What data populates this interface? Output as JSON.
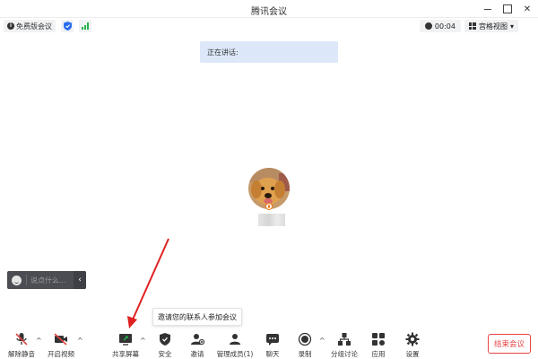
{
  "window": {
    "title": "腾讯会议"
  },
  "infobar": {
    "meeting_type": "免费版会议",
    "timer": "00:04",
    "view_mode": "宫格视图"
  },
  "speaking": {
    "label": "正在讲话:"
  },
  "chat": {
    "placeholder": "说点什么..."
  },
  "tooltip": {
    "text": "邀请您的联系人参加会议"
  },
  "toolbar": {
    "items": [
      {
        "label": "解除静音",
        "icon": "mic-muted-icon"
      },
      {
        "label": "开启视频",
        "icon": "video-off-icon"
      },
      {
        "label": "共享屏幕",
        "icon": "share-screen-icon"
      },
      {
        "label": "安全",
        "icon": "shield-icon"
      },
      {
        "label": "邀请",
        "icon": "invite-icon"
      },
      {
        "label": "管理成员(1)",
        "icon": "members-icon"
      },
      {
        "label": "聊天",
        "icon": "chat-icon"
      },
      {
        "label": "录制",
        "icon": "record-icon"
      },
      {
        "label": "分组讨论",
        "icon": "breakout-icon"
      },
      {
        "label": "应用",
        "icon": "apps-icon"
      },
      {
        "label": "设置",
        "icon": "gear-icon"
      }
    ],
    "end_label": "结束会议"
  },
  "colors": {
    "accent_red": "#e64545",
    "speaking_bg": "#dce8f9",
    "signal_green": "#24b24b",
    "annotation_red": "#e02020"
  }
}
